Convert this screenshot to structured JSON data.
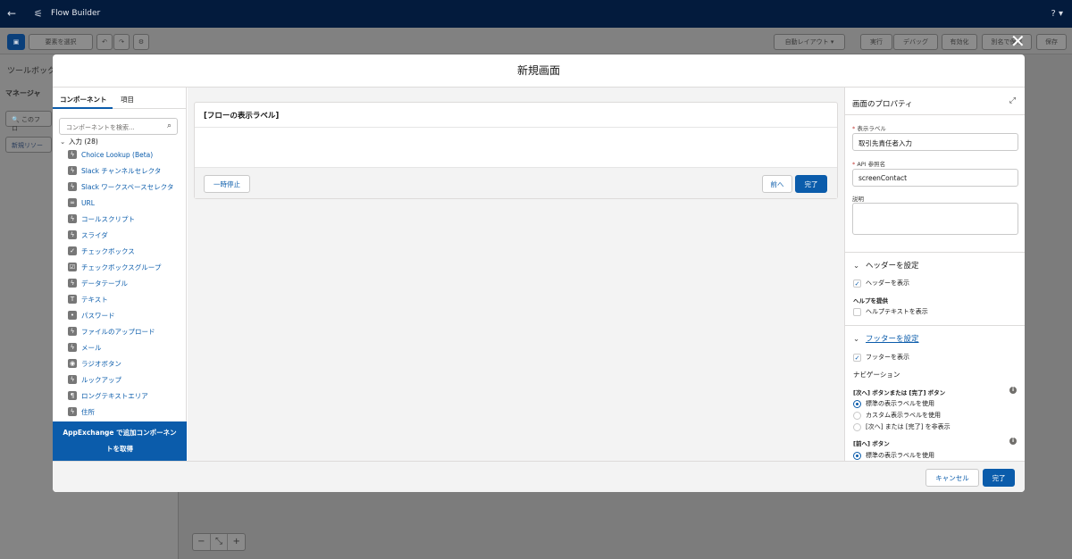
{
  "app": {
    "title": "Flow Builder",
    "help": "? ▾"
  },
  "toolbar": {
    "select_elements": "要素を選択",
    "auto_layout": "自動レイアウト",
    "run": "実行",
    "debug": "デバッグ",
    "activate": "有効化",
    "save_as": "別名で保存",
    "save": "保存"
  },
  "toolbox": {
    "title": "ツールボック",
    "tab_manager": "マネージャ",
    "search": "このフロ",
    "new_resource": "新規リソー"
  },
  "zoom": {
    "minus": "−",
    "fit": "⤡",
    "plus": "+"
  },
  "modal": {
    "title": "新規画面",
    "cancel": "キャンセル",
    "done": "完了"
  },
  "palette": {
    "tab_components": "コンポーネント",
    "tab_fields": "項目",
    "search_placeholder": "コンポーネントを検索...",
    "group_label": "入力 (28)",
    "items": [
      {
        "label": "Choice Lookup (Beta)",
        "icon": "lightning-icon"
      },
      {
        "label": "Slack チャンネルセレクタ",
        "icon": "lightning-icon"
      },
      {
        "label": "Slack ワークスペースセレクタ",
        "icon": "lightning-icon"
      },
      {
        "label": "URL",
        "icon": "link-icon"
      },
      {
        "label": "コールスクリプト",
        "icon": "lightning-icon"
      },
      {
        "label": "スライダ",
        "icon": "lightning-icon"
      },
      {
        "label": "チェックボックス",
        "icon": "checkbox-icon"
      },
      {
        "label": "チェックボックスグループ",
        "icon": "checkbox-group-icon"
      },
      {
        "label": "データテーブル",
        "icon": "lightning-icon"
      },
      {
        "label": "テキスト",
        "icon": "text-icon"
      },
      {
        "label": "パスワード",
        "icon": "password-icon"
      },
      {
        "label": "ファイルのアップロード",
        "icon": "lightning-icon"
      },
      {
        "label": "メール",
        "icon": "lightning-icon"
      },
      {
        "label": "ラジオボタン",
        "icon": "radio-icon"
      },
      {
        "label": "ルックアップ",
        "icon": "lightning-icon"
      },
      {
        "label": "ロングテキストエリア",
        "icon": "textarea-icon"
      },
      {
        "label": "住所",
        "icon": "lightning-icon"
      }
    ],
    "appexchange_line1": "AppExchange で追加コンポーネン",
    "appexchange_line2": "トを取得"
  },
  "canvas": {
    "screen_title": "[フローの表示ラベル]",
    "pause": "一時停止",
    "previous": "前へ",
    "finish": "完了"
  },
  "props": {
    "title": "画面のプロパティ",
    "label_field_label": "表示ラベル",
    "label_field_value": "取引先責任者入力",
    "api_field_label": "API 参照名",
    "api_field_value": "screenContact",
    "description_label": "説明",
    "header_section": "ヘッダーを設定",
    "show_header": "ヘッダーを表示",
    "help_provide": "ヘルプを提供",
    "show_help_text": "ヘルプテキストを表示",
    "footer_section": "フッターを設定",
    "show_footer": "フッターを表示",
    "navigation": "ナビゲーション",
    "next_finish_label": "[次へ] ボタンまたは [完了] ボタン",
    "radio_standard": "標準の表示ラベルを使用",
    "radio_custom": "カスタム表示ラベルを使用",
    "radio_hide": "[次へ] または [完了] を非表示",
    "prev_label": "[前へ] ボタン",
    "radio_standard_prev": "標準の表示ラベルを使用"
  }
}
